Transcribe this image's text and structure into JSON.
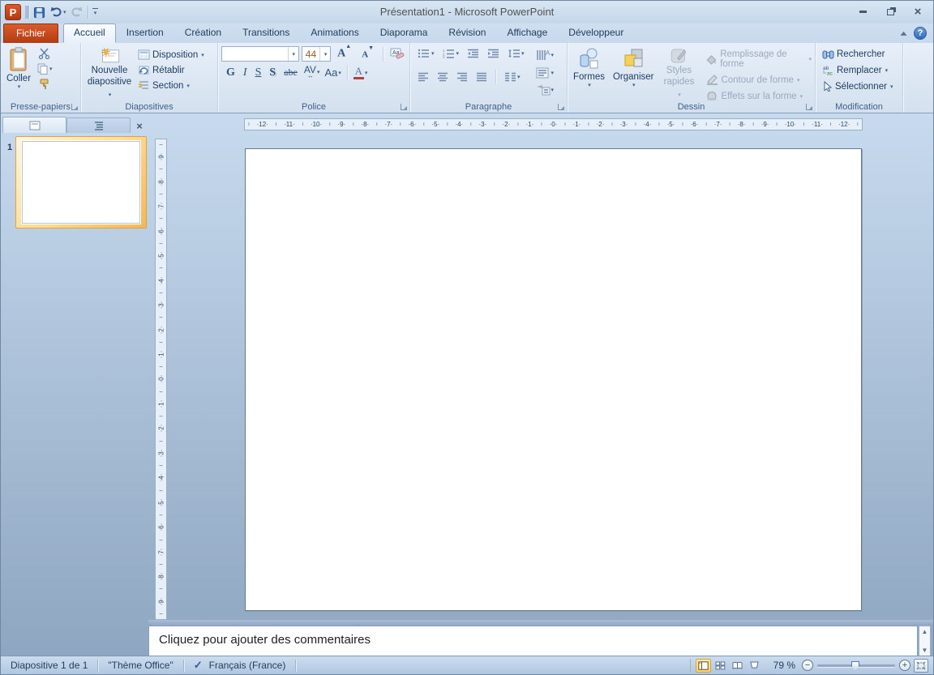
{
  "window": {
    "title": "Présentation1  -  Microsoft PowerPoint"
  },
  "icons": {
    "close_window": "×",
    "help": "?",
    "collapse_ribbon": "▴",
    "close_pane": "×",
    "scroll_up": "▲",
    "scroll_down": "▼",
    "zoom_out": "−",
    "zoom_in": "+",
    "spell_check": "✓"
  },
  "tabs": {
    "file": "Fichier",
    "active": "Accueil",
    "items": [
      "Accueil",
      "Insertion",
      "Création",
      "Transitions",
      "Animations",
      "Diaporama",
      "Révision",
      "Affichage",
      "Développeur"
    ]
  },
  "ribbon": {
    "clipboard": {
      "label": "Presse-papiers",
      "paste": "Coller"
    },
    "slides": {
      "label": "Diapositives",
      "new_slide_line1": "Nouvelle",
      "new_slide_line2": "diapositive",
      "layout": "Disposition",
      "reset": "Rétablir",
      "section": "Section"
    },
    "font": {
      "label": "Police",
      "name_value": "",
      "size_value": "44",
      "grow": "A",
      "shrink": "A",
      "bold": "G",
      "italic": "I",
      "underline": "S",
      "shadow": "S",
      "strikethrough": "abe",
      "char_spacing": "AV",
      "change_case": "Aa",
      "font_color": "A"
    },
    "paragraph": {
      "label": "Paragraphe"
    },
    "drawing": {
      "label": "Dessin",
      "shapes": "Formes",
      "arrange": "Organiser",
      "quick_styles_1": "Styles",
      "quick_styles_2": "rapides",
      "fill": "Remplissage de forme",
      "outline": "Contour de forme",
      "effects": "Effets sur la forme"
    },
    "editing": {
      "label": "Modification",
      "find": "Rechercher",
      "replace": "Remplacer",
      "select": "Sélectionner"
    }
  },
  "slides_panel": {
    "slide_number": "1"
  },
  "rulers": {
    "horizontal": [
      12,
      11,
      10,
      9,
      8,
      7,
      6,
      5,
      4,
      3,
      2,
      1,
      0,
      1,
      2,
      3,
      4,
      5,
      6,
      7,
      8,
      9,
      10,
      11,
      12
    ],
    "vertical": [
      9,
      8,
      7,
      6,
      5,
      4,
      3,
      2,
      1,
      0,
      1,
      2,
      3,
      4,
      5,
      6,
      7,
      8,
      9
    ]
  },
  "notes": {
    "placeholder": "Cliquez pour ajouter des commentaires"
  },
  "status": {
    "slide_indicator": "Diapositive 1 de 1",
    "theme": "\"Thème Office\"",
    "language": "Français (France)",
    "zoom_level": "79 %"
  }
}
